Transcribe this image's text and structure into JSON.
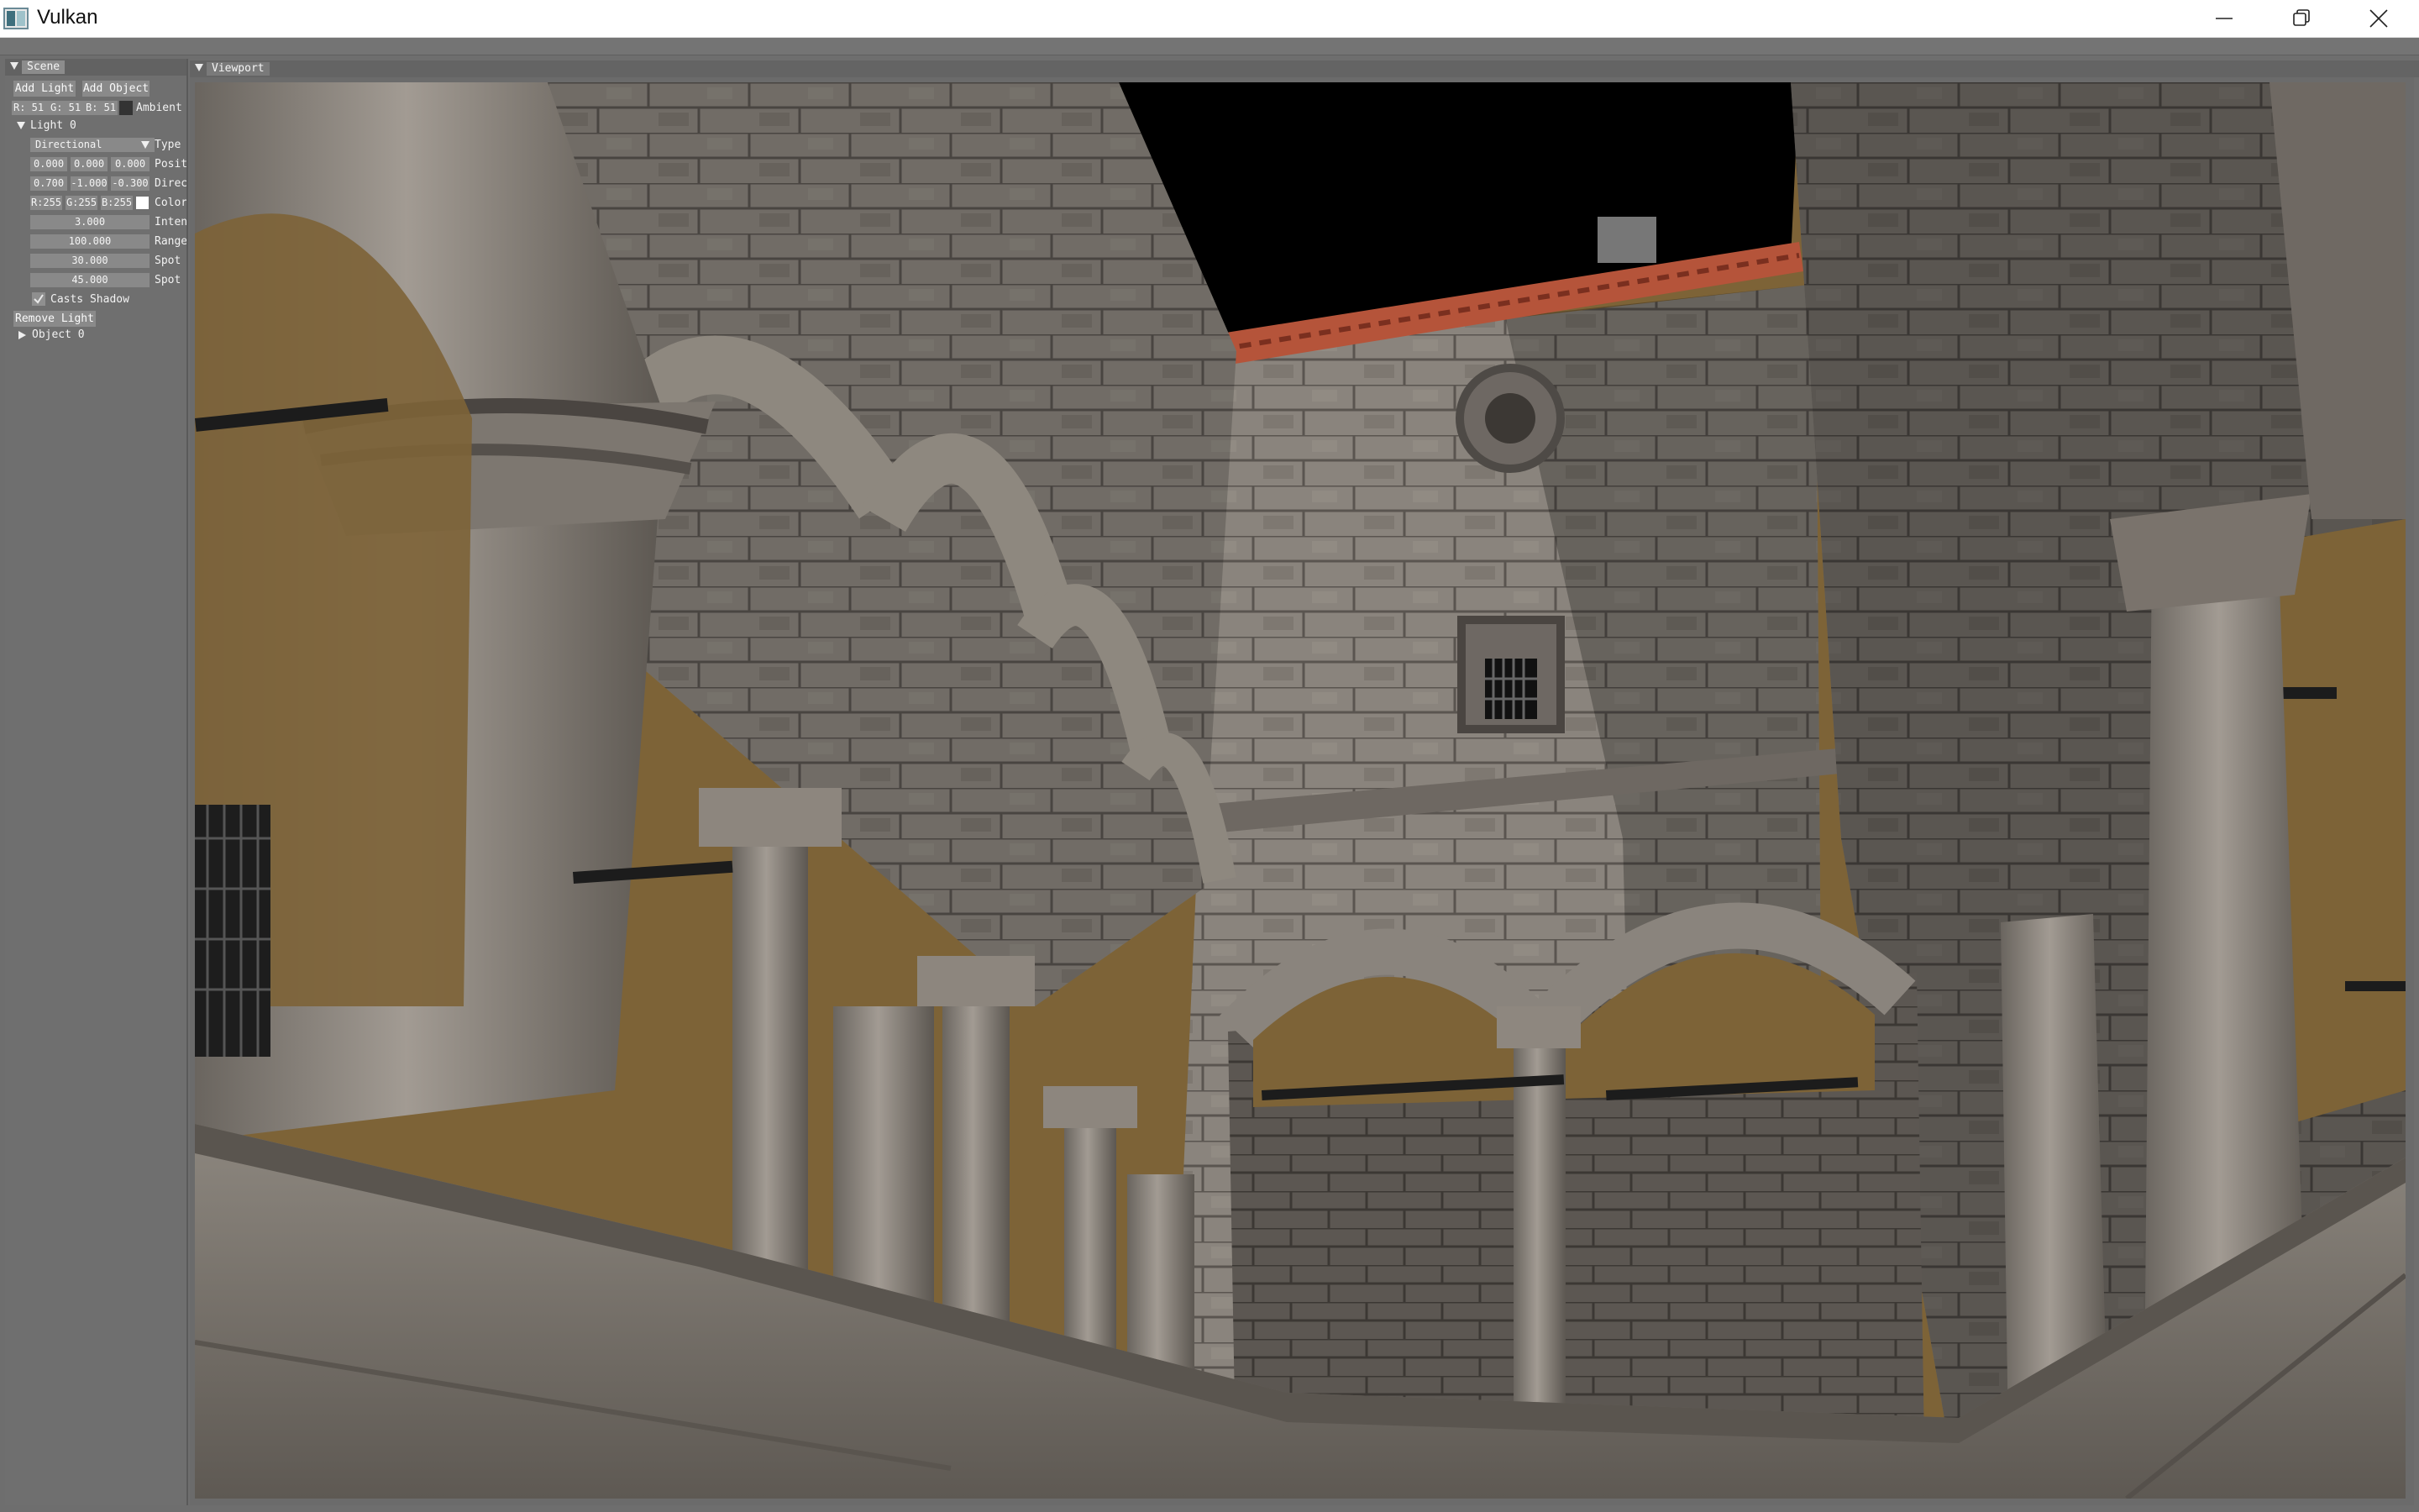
{
  "window": {
    "title": "Vulkan",
    "icons": {
      "app": "vulkan-app-icon",
      "minimize": "minimize-icon",
      "maximize": "restore-icon",
      "close": "close-icon"
    }
  },
  "scene_panel": {
    "tab_label": "Scene",
    "add_light": "Add Light",
    "add_object": "Add Object",
    "ambient": {
      "r": "R: 51",
      "g": "G: 51",
      "b": "B: 51",
      "label": "Ambient C"
    },
    "light0": {
      "header": "Light 0",
      "type_value": "Directional",
      "type_label": "Type",
      "position": [
        "0.000",
        "0.000",
        "0.000"
      ],
      "position_label": "Positi",
      "direction": [
        "0.700",
        "-1.000",
        "-0.300"
      ],
      "direction_label": "Direct",
      "color": {
        "r": "R:255",
        "g": "G:255",
        "b": "B:255"
      },
      "color_label": "Color",
      "intensity": "3.000",
      "intensity_label": "Intens",
      "range": "100.000",
      "range_label": "Range",
      "spot_inner": "30.000",
      "spot_inner_label": "Spot I",
      "spot_outer": "45.000",
      "spot_outer_label": "Spot O",
      "casts_shadow_label": "Casts Shadow",
      "casts_shadow": true
    },
    "remove_light": "Remove Light",
    "object0": "Object 0"
  },
  "viewport": {
    "tab_label": "Viewport",
    "image": "3D render of a stone courtyard with arched colonnades",
    "colors": {
      "stone": "#8a847d",
      "plaster": "#7d6337",
      "sky": "#000000",
      "roof": "#b5543a"
    }
  }
}
